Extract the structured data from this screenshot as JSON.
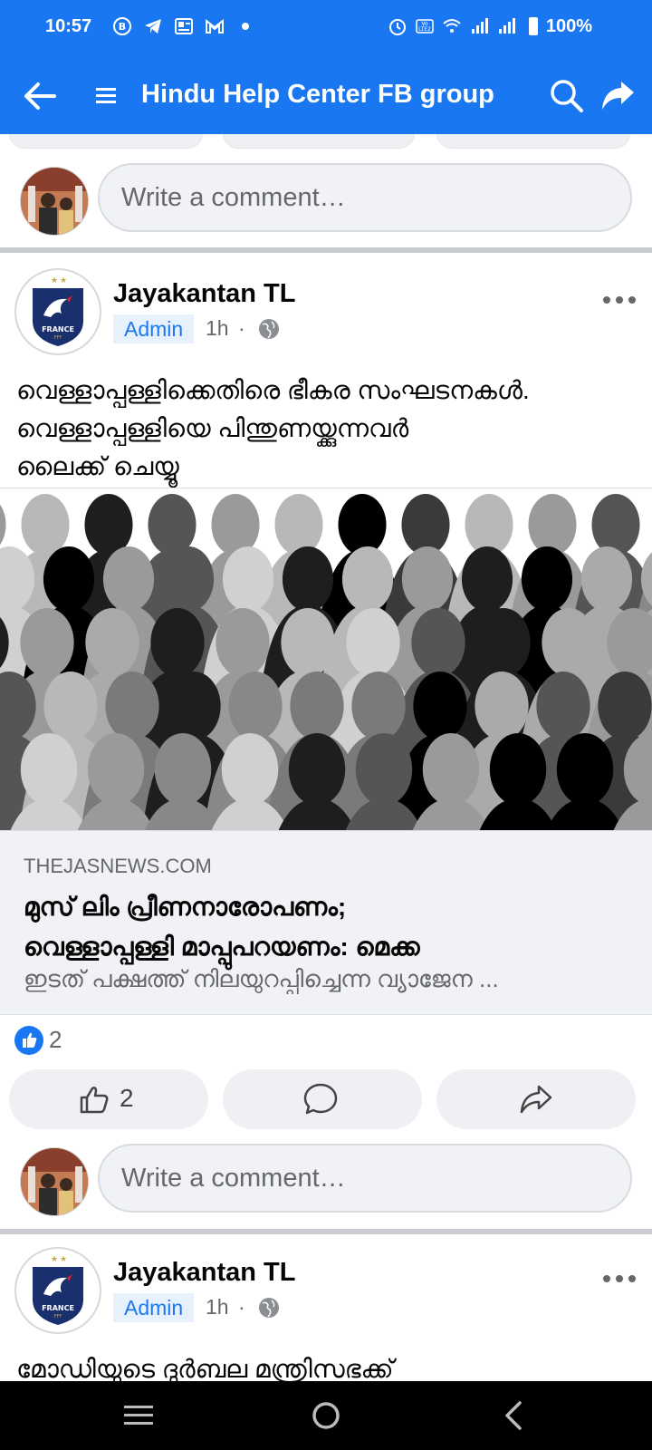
{
  "status_bar": {
    "time": "10:57",
    "battery": "100%"
  },
  "app_bar": {
    "title": "Hindu Help Center FB group"
  },
  "comment_placeholder": "Write a comment…",
  "post1": {
    "author": "Jayakantan TL",
    "role": "Admin",
    "time": "1h",
    "separator": "·",
    "text_line1": "വെള്ളാപ്പള്ളിക്കെതിരെ ഭീകര സംഘടനകൾ.",
    "text_line2": "വെള്ളാപ്പള്ളിയെ പിന്തുണയ്ക്കുന്നവർ",
    "text_line3": "ലൈക്ക് ചെയ്യൂ",
    "link": {
      "domain": "THEJASNEWS.COM",
      "title_line1": "മുസ് ലിം പ്രീണനാരോപണം;",
      "title_line2": "വെള്ളാപ്പള്ളി മാപ്പുപറയണം: മെക്ക",
      "description": "ഇടത് പക്ഷത്ത് നിലയുറപ്പിച്ചെന്ന വ്യാജേന ..."
    },
    "reaction_count": "2",
    "like_count": "2"
  },
  "post2": {
    "author": "Jayakantan TL",
    "role": "Admin",
    "time": "1h",
    "separator": "·",
    "text_line1": "മോഡിയുടെ ദുർബല മന്ത്രിസഭക്ക്"
  },
  "colors": {
    "facebook_blue": "#1a77f2",
    "admin_badge_bg": "#e7f1fe",
    "divider": "#c9ccd1"
  },
  "icons": {
    "back": "arrow-left-icon",
    "menu": "hamburger-icon",
    "search": "search-icon",
    "share": "share-arrow-icon",
    "globe": "globe-icon",
    "more": "more-dots-icon",
    "like": "thumbs-up-icon",
    "comment": "speech-bubble-icon",
    "forward": "forward-arrow-icon"
  }
}
